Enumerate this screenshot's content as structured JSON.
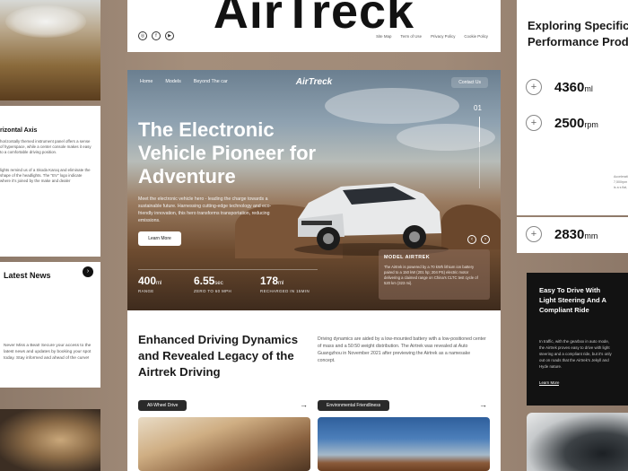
{
  "left": {
    "heading": "rizontal Axis",
    "body1": "horizontally themed instrument panel offers a sense of hyperspace, while a center console makes it easy to a comfortable driving position.",
    "body2": "lights remind us of a Skoda Karoq and eliminate the shape of the headlights. The \"EV\" logo indicate where it's joined by the make and dealer",
    "news_title": "Latest News",
    "news_btn": "›",
    "news_body": "Never Miss a Beat! Secure your access to the latest news and updates by booking your spot today. Stay informed and ahead of the curve!"
  },
  "header": {
    "big_logo": "AirTreck",
    "socials": [
      "◎",
      "f",
      "▶"
    ],
    "links": [
      "Site Map",
      "Term of Use",
      "Privacy Policy",
      "Cookie Policy"
    ]
  },
  "hero": {
    "nav": [
      "Home",
      "Models",
      "Beyond The car"
    ],
    "brand": "AirTreck",
    "contact": "Contact Us",
    "title": "The Electronic Vehicle Pioneer for Adventure",
    "desc": "Meet the electronic vehicle hero - leading the charge towards a sustainable future. Harnessing cutting-edge technology and eco-friendly innovation, this hero transforms transportation, reducing emissions.",
    "learn_more": "Learn More",
    "slide_number": "01",
    "stats": [
      {
        "value": "400",
        "unit": "ml",
        "label": "RANGE"
      },
      {
        "value": "6.55",
        "unit": "sec",
        "label": "ZERO TO 60 MPH"
      },
      {
        "value": "178",
        "unit": "ml",
        "label": "RECHARGED IN 15MIN"
      }
    ],
    "model_title": "MODEL AIRTREK",
    "model_body": "The Airtrek is powered by a 70 kWh lithium ion battery paired to a 150 kW (201 hp; 204 PS) electric motor delivering a claimed range on China's CLTC test cycle of 520 km (323 mi)."
  },
  "section2": {
    "heading": "Enhanced Driving Dynamics and Revealed Legacy of the Airtrek Driving",
    "desc": "Driving dynamics are aided by a low-mounted battery with a low-positioned center of mass and a 50:50 weight distribution. The Airtrek was revealed at Auto Guangzhou in November 2021 after previewing the Airtrek as a namesake concept.",
    "tags": [
      "All-Wheel Drive",
      "Environmental Friendliness"
    ],
    "arrow": "→"
  },
  "right": {
    "heading_line1": "Exploring Specific",
    "heading_line2": "Performance Prod",
    "specs": [
      {
        "value": "4360",
        "unit": "ml"
      },
      {
        "value": "2500",
        "unit": "rpm"
      },
      {
        "value": "2830",
        "unit": "mm"
      }
    ],
    "sidetext": "Acceleration 7,500rpm it is a s flat, st",
    "dark_title": "Easy To Drive With Light Steering And A Compliant Ride",
    "dark_body": "In traffic, with the gearbox in auto mode, the Airtrek proves easy to drive with light steering and a compliant ride, but it's only out on roads that the Airtrek's Jekyll and Hyde nature.",
    "dark_link": "Learn More"
  }
}
